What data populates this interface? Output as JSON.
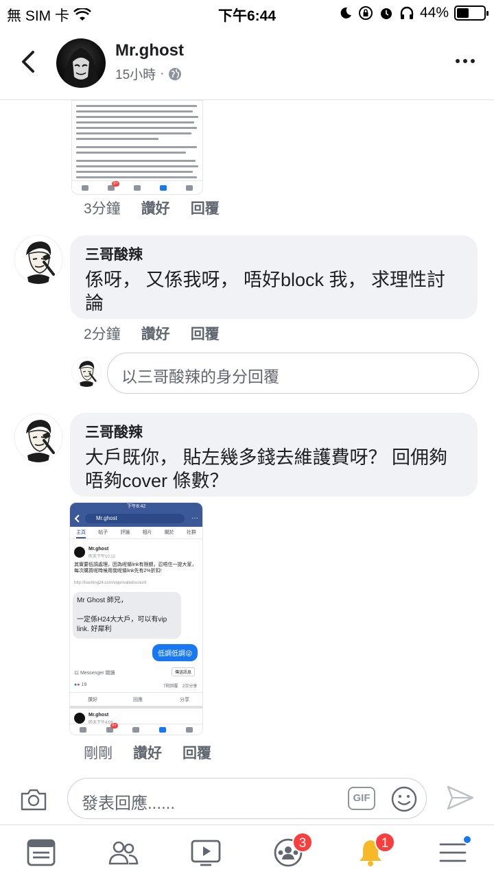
{
  "status_bar": {
    "carrier": "無 SIM 卡",
    "time": "下午6:44",
    "battery": "44%",
    "battery_level": 0.44
  },
  "header": {
    "name": "Mr.ghost",
    "time_ago": "15小時",
    "separator": "·"
  },
  "comment_actions": {
    "like": "讚好",
    "reply": "回覆"
  },
  "first_item": {
    "time": "3分鐘",
    "screenshot_badge": "9+"
  },
  "comments": [
    {
      "author": "三哥酸辣",
      "text": "係呀， 又係我呀， 唔好block 我， 求理性討論",
      "time": "2分鐘"
    },
    {
      "author": "三哥酸辣",
      "text": "大戶既你， 貼左幾多錢去維護費呀？ 回佣夠唔夠cover 條數？",
      "time": "剛剛"
    }
  ],
  "reply_placeholder": "以三哥酸辣的身分回覆",
  "attached_screenshot": {
    "status_time": "下午8:42",
    "search_text": "Mr.ghost",
    "tabs": [
      "主頁",
      "帖子",
      "評論",
      "相片",
      "關於",
      "社群"
    ],
    "post_author": "Mr.ghost",
    "post_time": "昨天下午10:12",
    "post_text": "其實要低調處理，因為呢條link有限額，忍唔住一提大家，每次購買呢時候用我呢條link先有2%折扣!",
    "post_link": "http://hashing24.com/vipprivatediscount",
    "message_text": "Mr Ghost 師兄，\n\n一定係H24大大戶，可以有vip link. 好犀利",
    "blue_reply": "低調低調😜",
    "messenger_label": "以 Messenger 閱讀",
    "send_label": "傳送訊息",
    "reactions_count": "19",
    "comments_count": "7則回覆",
    "shares_count": "2次分享",
    "like_label": "讚好",
    "reply_label": "回應",
    "share_label": "分享",
    "next_author": "Mr.ghost",
    "next_time": "昨天下午4:08",
    "badge": "9+"
  },
  "composer": {
    "placeholder": "發表回應......",
    "gif_label": "GIF"
  },
  "bottom_nav": {
    "groups_badge": "3",
    "notifications_badge": "1"
  },
  "colors": {
    "accent": "#1877f2",
    "badge_red": "#fa3e3e",
    "bubble_bg": "#f0f2f5",
    "facebook_blue": "#3b5998"
  }
}
